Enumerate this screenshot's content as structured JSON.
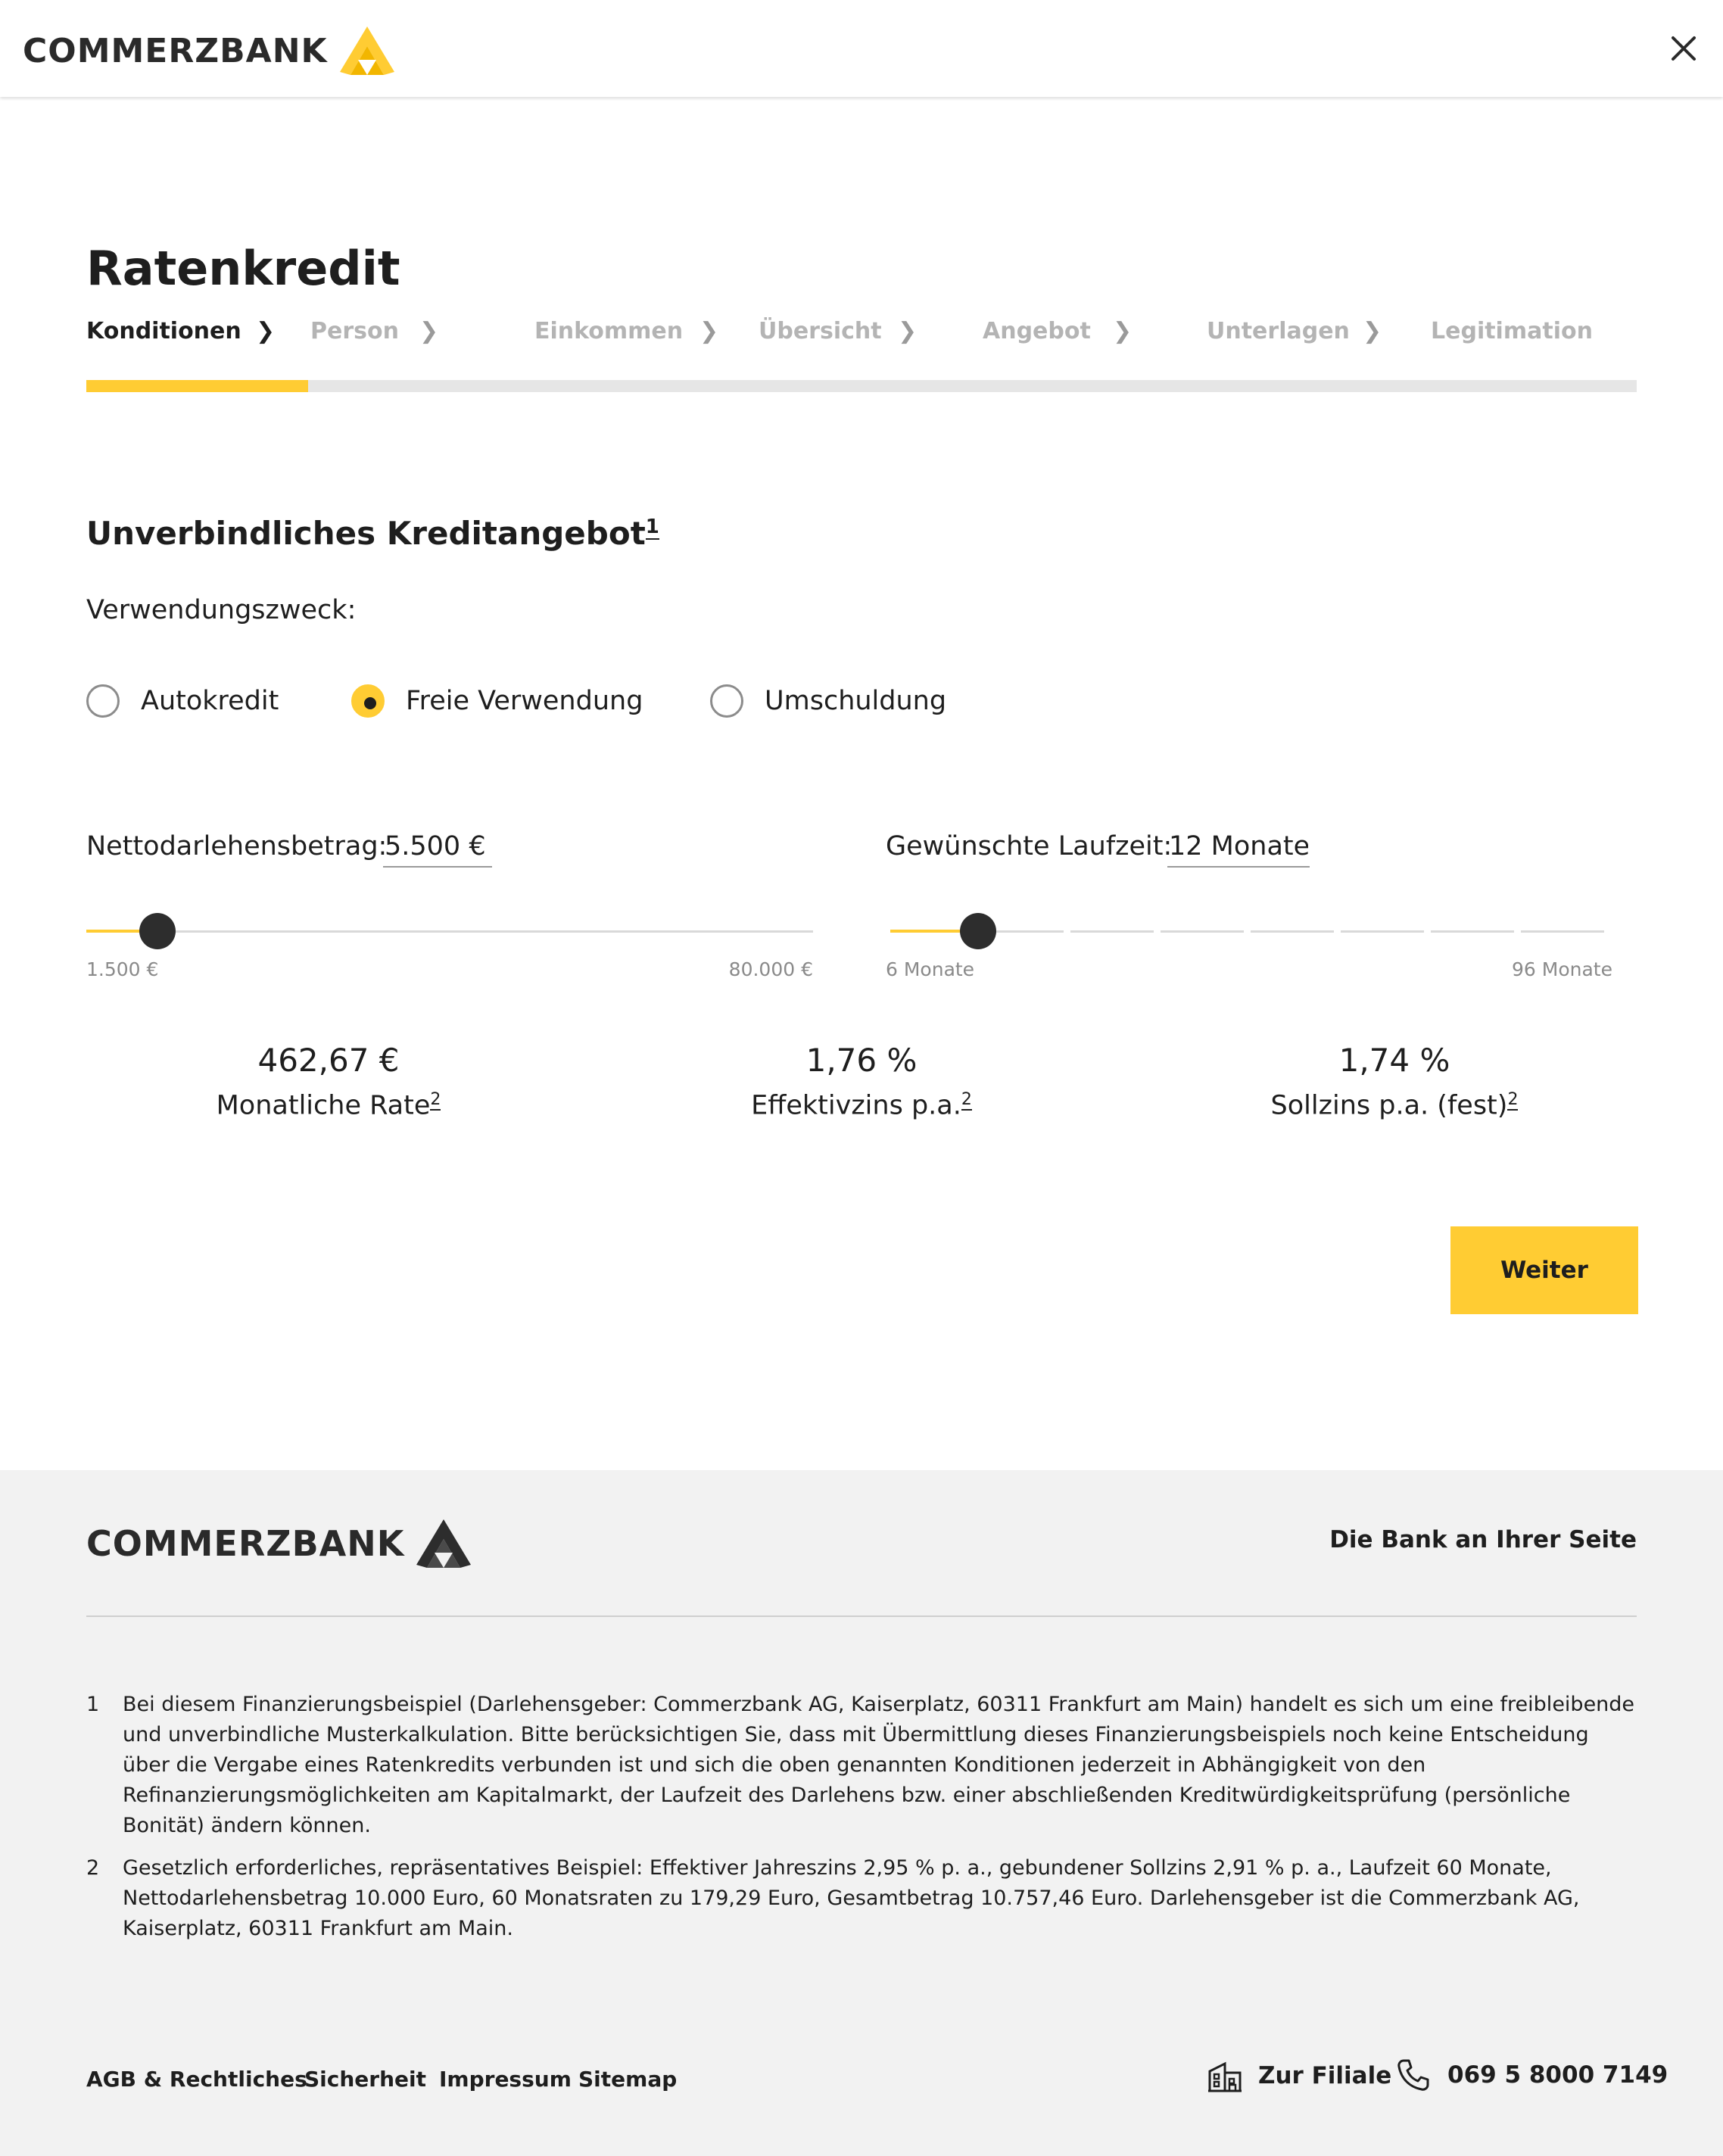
{
  "header": {
    "brand": "COMMERZBANK",
    "close_icon": "close-icon"
  },
  "page": {
    "title": "Ratenkredit",
    "steps": [
      {
        "label": "Konditionen",
        "active": true
      },
      {
        "label": "Person",
        "active": false
      },
      {
        "label": "Einkommen",
        "active": false
      },
      {
        "label": "Übersicht",
        "active": false
      },
      {
        "label": "Angebot",
        "active": false
      },
      {
        "label": "Unterlagen",
        "active": false
      },
      {
        "label": "Legitimation",
        "active": false
      }
    ],
    "progress_fraction": 0.143
  },
  "offer": {
    "title": "Unverbindliches Kreditangebot",
    "title_footnote": "1",
    "purpose_label": "Verwendungszweck:",
    "purposes": [
      {
        "label": "Autokredit",
        "checked": false
      },
      {
        "label": "Freie Verwendung",
        "checked": true
      },
      {
        "label": "Umschuldung",
        "checked": false
      }
    ],
    "amount": {
      "label": "Nettodarlehensbetrag:",
      "value": "5.500 €",
      "min_label": "1.500 €",
      "max_label": "80.000 €",
      "min": 1500,
      "max": 80000,
      "current": 5500
    },
    "term": {
      "label": "Gewünschte Laufzeit:",
      "value": "12 Monate",
      "min_label": "6 Monate",
      "max_label": "96 Monate",
      "min": 6,
      "max": 96,
      "current": 12
    },
    "results": [
      {
        "value": "462,67 €",
        "label": "Monatliche Rate",
        "footnote": "2"
      },
      {
        "value": "1,76 %",
        "label": "Effektivzins p.a.",
        "footnote": "2"
      },
      {
        "value": "1,74 %",
        "label": "Sollzins p.a. (fest)",
        "footnote": "2"
      }
    ],
    "next_label": "Weiter"
  },
  "footer": {
    "brand": "COMMERZBANK",
    "tagline": "Die Bank an Ihrer Seite",
    "footnotes": [
      {
        "num": "1",
        "text": "Bei diesem Finanzierungsbeispiel (Darlehensgeber: Commerzbank AG, Kaiserplatz, 60311 Frankfurt am Main) handelt es sich um eine freibleibende und unverbindliche Musterkalkulation. Bitte berücksichtigen Sie, dass mit Übermittlung dieses Finanzierungsbeispiels noch keine Entscheidung über die Vergabe eines Ratenkredits verbunden ist und sich die oben genannten Konditionen jederzeit in Abhängigkeit von den Refinanzierungsmöglichkeiten am Kapitalmarkt, der Laufzeit des Darlehens bzw. einer abschließenden Kreditwürdigkeitsprüfung (persönliche Bonität) ändern können."
      },
      {
        "num": "2",
        "text": "Gesetzlich erforderliches, repräsentatives Beispiel: Effektiver Jahreszins 2,95 % p. a., gebundener Sollzins 2,91 % p. a., Laufzeit 60 Monate, Nettodarlehensbetrag 10.000 Euro, 60 Monatsraten zu 179,29 Euro, Gesamtbetrag 10.757,46 Euro. Darlehensgeber ist die Commerzbank AG, Kaiserplatz, 60311 Frankfurt am Main."
      }
    ],
    "links": [
      "AGB & Rechtliches",
      "Sicherheit",
      "Impressum",
      "Sitemap"
    ],
    "branch_label": "Zur Filiale",
    "phone": "069 5 8000 7149"
  },
  "colors": {
    "accent": "#ffcc33",
    "text": "#1e1e1e",
    "muted": "#b4b4b4",
    "footer_bg": "#f2f2f2"
  }
}
